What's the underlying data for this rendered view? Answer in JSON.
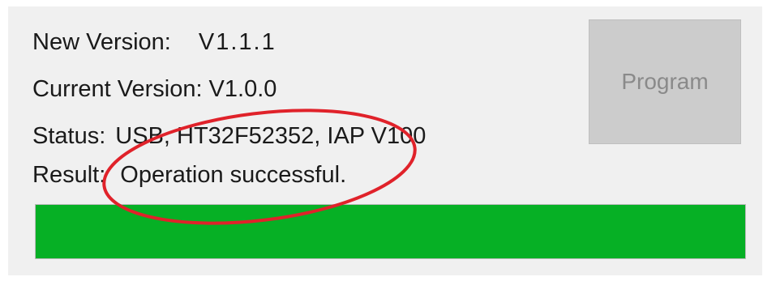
{
  "info": {
    "new_version_label": "New Version:",
    "new_version_value": "V1.1.1",
    "current_version_label": "Current Version:",
    "current_version_value": "V1.0.0",
    "status_label": "Status:",
    "status_value": "USB, HT32F52352, IAP V100",
    "result_label": "Result:",
    "result_value": "Operation successful."
  },
  "program_button": {
    "label": "Program",
    "enabled": false
  },
  "progress": {
    "percent": 100,
    "fill_color": "#06b025"
  },
  "annotation": {
    "shape": "ellipse",
    "color": "#e0222a"
  }
}
